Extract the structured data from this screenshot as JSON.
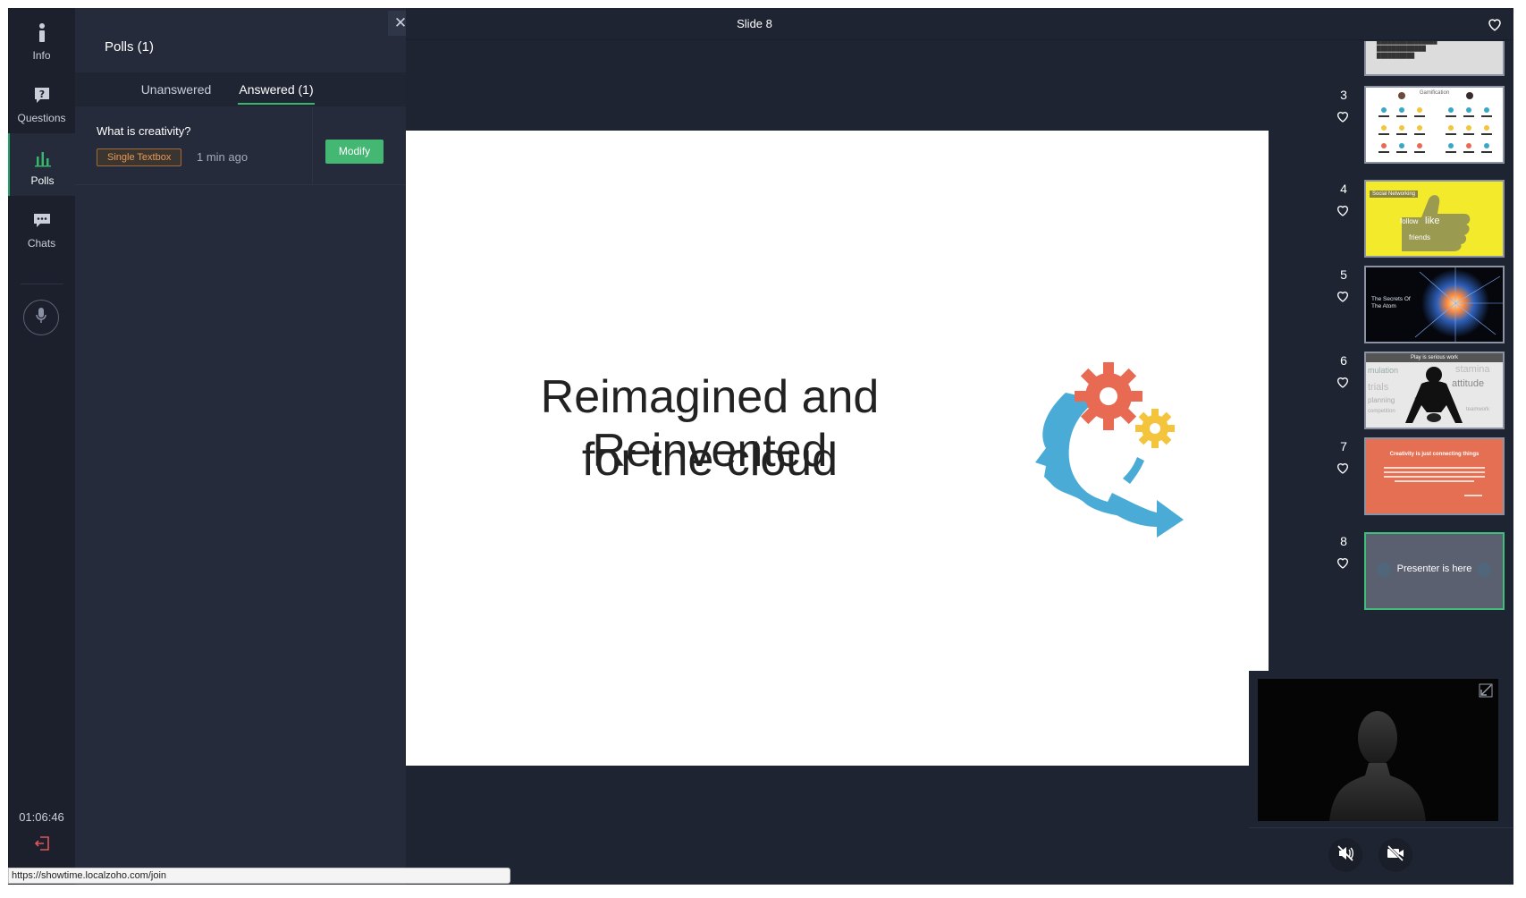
{
  "rail": {
    "items": [
      {
        "label": "Info",
        "icon": "info-icon"
      },
      {
        "label": "Questions",
        "icon": "question-bubble-icon"
      },
      {
        "label": "Polls",
        "icon": "bar-chart-icon"
      },
      {
        "label": "Chats",
        "icon": "chat-bubble-icon"
      }
    ],
    "timer": "01:06:46",
    "exit_label": "Exit"
  },
  "panel": {
    "title": "Polls (1)",
    "tabs": [
      "Unanswered",
      "Answered (1)"
    ],
    "active_tab": "Answered (1)",
    "polls": [
      {
        "question": "What is creativity?",
        "type": "Single Textbox",
        "time": "1 min ago",
        "action": "Modify"
      }
    ]
  },
  "header": {
    "title": "Slide 8"
  },
  "slide": {
    "line1": "Reimagined and Reinvented",
    "line2": "for the cloud"
  },
  "thumbs": [
    {
      "num": "3",
      "title": "Gamification"
    },
    {
      "num": "4",
      "title": "Social Networking",
      "words": [
        "follow",
        "like",
        "friends"
      ]
    },
    {
      "num": "5",
      "title": "The Secrets Of The Atom"
    },
    {
      "num": "6",
      "title": "Play is serious work",
      "words": [
        "mulation",
        "stamina",
        "trials",
        "attitude",
        "planning",
        "sweat",
        "competition",
        "teamwork"
      ]
    },
    {
      "num": "7",
      "title": "Creativity is just connecting things"
    },
    {
      "num": "8",
      "title": "Presenter is here",
      "current": true
    }
  ],
  "status_url": "https://showtime.localzoho.com/join",
  "colors": {
    "accent": "#38b76b",
    "panel_bg": "#252b3a",
    "badge": "#e89a55",
    "slide7_bg": "#e46f52",
    "slide4_bg": "#f4ea2c"
  }
}
